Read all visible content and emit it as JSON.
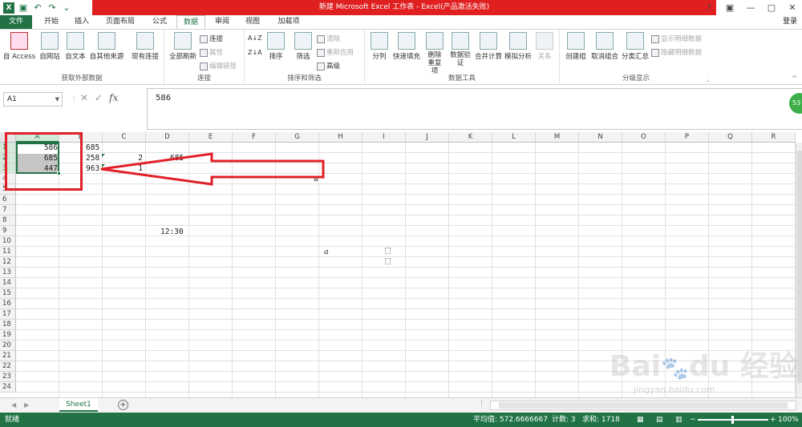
{
  "window": {
    "title": "新建 Microsoft Excel 工作表 - Excel(产品激活失败)",
    "login": "登录"
  },
  "qat": {
    "icons": [
      "excel-logo-icon",
      "save-icon",
      "undo-icon",
      "redo-icon",
      "customize-icon"
    ]
  },
  "window_buttons": [
    "?",
    "▣",
    "—",
    "▢",
    "✕"
  ],
  "tabs": [
    {
      "label": "文件"
    },
    {
      "label": "开始"
    },
    {
      "label": "插入"
    },
    {
      "label": "页面布局"
    },
    {
      "label": "公式"
    },
    {
      "label": "数据"
    },
    {
      "label": "审阅"
    },
    {
      "label": "视图"
    },
    {
      "label": "加载项"
    }
  ],
  "ribbon": {
    "groups": [
      {
        "label": "获取外部数据",
        "buttons": [
          "自 Access",
          "自网站",
          "自文本",
          "自其他来源",
          "现有连接"
        ]
      },
      {
        "label": "连接",
        "buttons": [
          "全部刷新"
        ],
        "small": [
          "连接",
          "属性",
          "编辑链接"
        ]
      },
      {
        "label": "排序和筛选",
        "buttons": [
          "排序",
          "筛选"
        ],
        "small": [
          "清除",
          "重新应用",
          "高级"
        ]
      },
      {
        "label": "数据工具",
        "buttons": [
          "分列",
          "快速填充",
          "删除重复项",
          "数据验证",
          "合并计算",
          "模拟分析",
          "关系"
        ]
      },
      {
        "label": "分级显示",
        "buttons": [
          "创建组",
          "取消组合",
          "分类汇总"
        ],
        "small": [
          "显示明细数据",
          "隐藏明细数据"
        ]
      }
    ]
  },
  "namebox": "A1",
  "formula": "586",
  "greenball": "53",
  "columns": [
    "A",
    "B",
    "C",
    "D",
    "E",
    "F",
    "G",
    "H",
    "I",
    "J",
    "K",
    "L",
    "M",
    "N",
    "O",
    "P",
    "Q",
    "R"
  ],
  "rows": [
    "1",
    "2",
    "3",
    "4",
    "5",
    "6",
    "7",
    "8",
    "9",
    "10",
    "11",
    "12",
    "13",
    "14",
    "15",
    "16",
    "17",
    "18",
    "19",
    "20",
    "21",
    "22",
    "23",
    "24"
  ],
  "cells": {
    "A1": "586",
    "A2": "685",
    "A3": "447",
    "B1": "685",
    "B2": "258",
    "B3": "963",
    "C2": "2",
    "C3": "1",
    "D2": "685",
    "D9": "12:30",
    "H4": "a",
    "H11": "a"
  },
  "sheets": [
    "Sheet1"
  ],
  "status": {
    "ready": "就绪",
    "average": "平均值: 572.6666667",
    "count": "计数: 3",
    "sum": "求和: 1718",
    "zoom": "100%"
  },
  "colors": {
    "excel_green": "#217346",
    "title_red": "#e02020",
    "annotation_red": "#e01f26"
  },
  "watermark": {
    "brand": "Baidu 经验",
    "url": "jingyan.baidu.com"
  }
}
